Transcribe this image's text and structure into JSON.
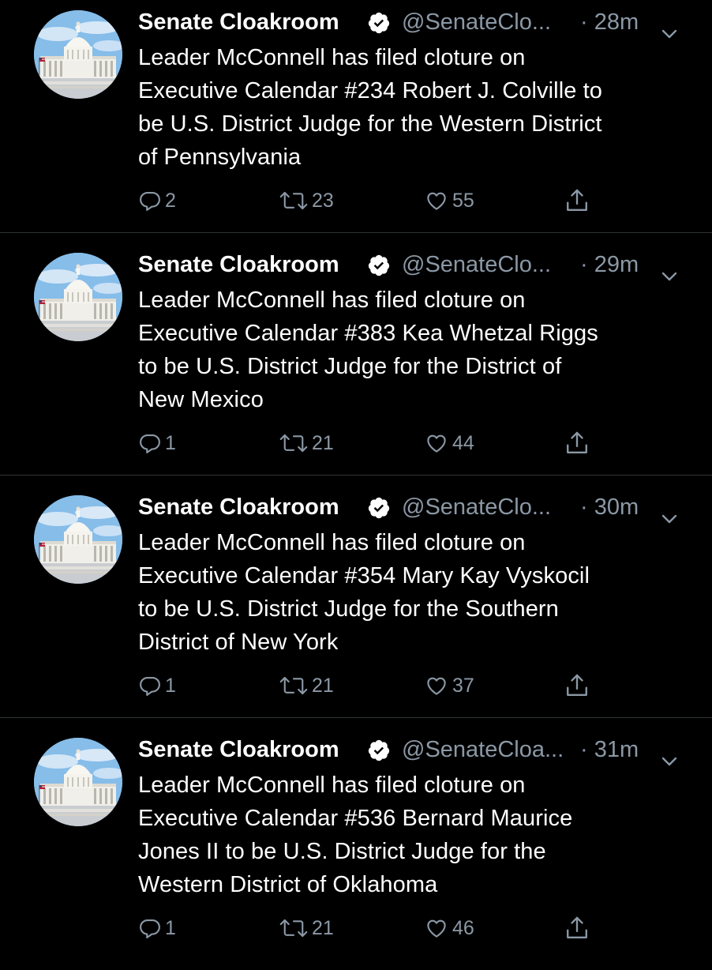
{
  "colors": {
    "background": "#000000",
    "text": "#ffffff",
    "secondary": "#8b98a5",
    "divider": "#2f3336",
    "verified_badge": "#ffffff"
  },
  "tweets": [
    {
      "name": "Senate Cloakroom",
      "handle": "@SenateClo...",
      "time": "· 28m",
      "lines": [
        "Leader McConnell has filed cloture on",
        "Executive Calendar #234 Robert J. Colville to",
        "be U.S. District Judge for the Western District",
        "of Pennsylvania"
      ],
      "replies": "2",
      "retweets": "23",
      "likes": "55"
    },
    {
      "name": "Senate Cloakroom",
      "handle": "@SenateClo...",
      "time": "· 29m",
      "lines": [
        "Leader McConnell has filed cloture on",
        "Executive Calendar #383 Kea Whetzal Riggs",
        "to be U.S. District Judge for the District of",
        "New Mexico"
      ],
      "replies": "1",
      "retweets": "21",
      "likes": "44"
    },
    {
      "name": "Senate Cloakroom",
      "handle": "@SenateClo...",
      "time": "· 30m",
      "lines": [
        "Leader McConnell has filed cloture on",
        "Executive Calendar #354 Mary Kay Vyskocil",
        "to be U.S. District Judge for the Southern",
        "District of New York"
      ],
      "replies": "1",
      "retweets": "21",
      "likes": "37"
    },
    {
      "name": "Senate Cloakroom",
      "handle": "@SenateCloa...",
      "time": "· 31m",
      "lines": [
        "Leader McConnell has filed cloture on",
        "Executive Calendar #536 Bernard Maurice",
        "Jones II to be U.S. District Judge for the",
        "Western District of Oklahoma"
      ],
      "replies": "1",
      "retweets": "21",
      "likes": "46"
    }
  ],
  "icons": {
    "avatar": "capitol-building-avatar",
    "verified": "verified-badge-icon",
    "more": "chevron-down-icon",
    "reply": "reply-icon",
    "retweet": "retweet-icon",
    "like": "heart-icon",
    "share": "share-icon"
  }
}
